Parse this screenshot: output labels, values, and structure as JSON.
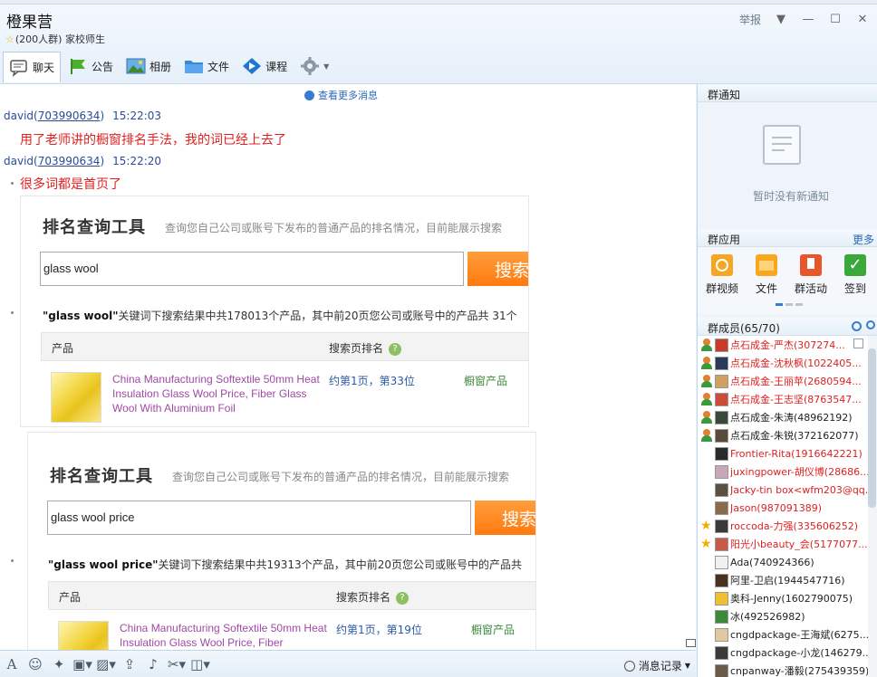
{
  "header": {
    "group_name": "橙果营",
    "member_count": "(200人群)",
    "category": "家校师生",
    "report_label": "举报"
  },
  "toolbar": {
    "chat": "聊天",
    "notice": "公告",
    "album": "相册",
    "files": "文件",
    "course": "课程"
  },
  "chat": {
    "more_messages": "查看更多消息",
    "messages": [
      {
        "user": "david",
        "uid": "703990634",
        "time": "15:22:03",
        "text": "用了老师讲的橱窗排名手法，我的词已经上去了"
      },
      {
        "user": "david",
        "uid": "703990634",
        "time": "15:22:20",
        "text": "很多词都是首页了"
      }
    ]
  },
  "shots": [
    {
      "title": "排名查询工具",
      "desc": "查询您自己公司或账号下发布的普通产品的排名情况，目前能展示搜索",
      "keyword": "glass wool",
      "button": "搜索",
      "result_kw": "\"glass wool\"",
      "result_rest": "关键词下搜索结果中共178013个产品，其中前20页您公司或账号中的产品共 31个",
      "col_product": "产品",
      "col_rank": "搜索页排名",
      "product": "China Manufacturing Softextile 50mm Heat Insulation Glass Wool Price, Fiber Glass Wool With Aluminium Foil",
      "rank": "约第1页，第33位",
      "category": "橱窗产品"
    },
    {
      "title": "排名查询工具",
      "desc": "查询您自己公司或账号下发布的普通产品的排名情况，目前能展示搜索",
      "keyword": "glass wool price",
      "button": "搜索",
      "result_kw": "\"glass wool price\"",
      "result_rest": "关键词下搜索结果中共19313个产品，其中前20页您公司或账号中的产品共",
      "col_product": "产品",
      "col_rank": "搜索页排名",
      "product": "China Manufacturing Softextile 50mm Heat Insulation Glass Wool Price, Fiber",
      "rank": "约第1页，第19位",
      "category": "橱窗产品"
    }
  ],
  "input_bar": {
    "message_log": "消息记录"
  },
  "right": {
    "notice_title": "群通知",
    "notice_empty": "暂时没有新通知",
    "apps_title": "群应用",
    "apps_more": "更多",
    "apps": [
      "群视频",
      "文件",
      "群活动",
      "签到"
    ],
    "members_title": "群成员(65/70)",
    "members": [
      {
        "name": "点石成金-严杰(307274...",
        "color": "#e02020"
      },
      {
        "name": "点石成金-沈秋枫(1022405...",
        "color": "#e02020"
      },
      {
        "name": "点石成金-王丽苹(2680594...",
        "color": "#e02020"
      },
      {
        "name": "点石成金-王志坚(8763547...",
        "color": "#e02020"
      },
      {
        "name": "点石成金-朱涛(48962192)",
        "color": "#222222"
      },
      {
        "name": "点石成金-朱锐(372162077)",
        "color": "#222222"
      },
      {
        "name": "Frontier-Rita(1916642221)",
        "color": "#e02020"
      },
      {
        "name": "juxingpower-胡仪博(28686...",
        "color": "#e02020"
      },
      {
        "name": "Jacky-tin box<wfm203@qq....",
        "color": "#e02020"
      },
      {
        "name": "Jason(987091389)",
        "color": "#e02020"
      },
      {
        "name": "roccoda-力强(335606252)",
        "color": "#e02020"
      },
      {
        "name": "阳光小beauty_会(5177077...",
        "color": "#e02020"
      },
      {
        "name": "Ada(740924366)",
        "color": "#222222"
      },
      {
        "name": "阿里-卫启(1944547716)",
        "color": "#222222"
      },
      {
        "name": "奥科-Jenny(1602790075)",
        "color": "#222222"
      },
      {
        "name": "冰(492526982)",
        "color": "#222222"
      },
      {
        "name": "cngdpackage-王海斌(6275...",
        "color": "#222222"
      },
      {
        "name": "cngdpackage-小龙(146279...",
        "color": "#222222"
      },
      {
        "name": "cnpanway-潘毅(275439359)",
        "color": "#222222"
      }
    ]
  }
}
